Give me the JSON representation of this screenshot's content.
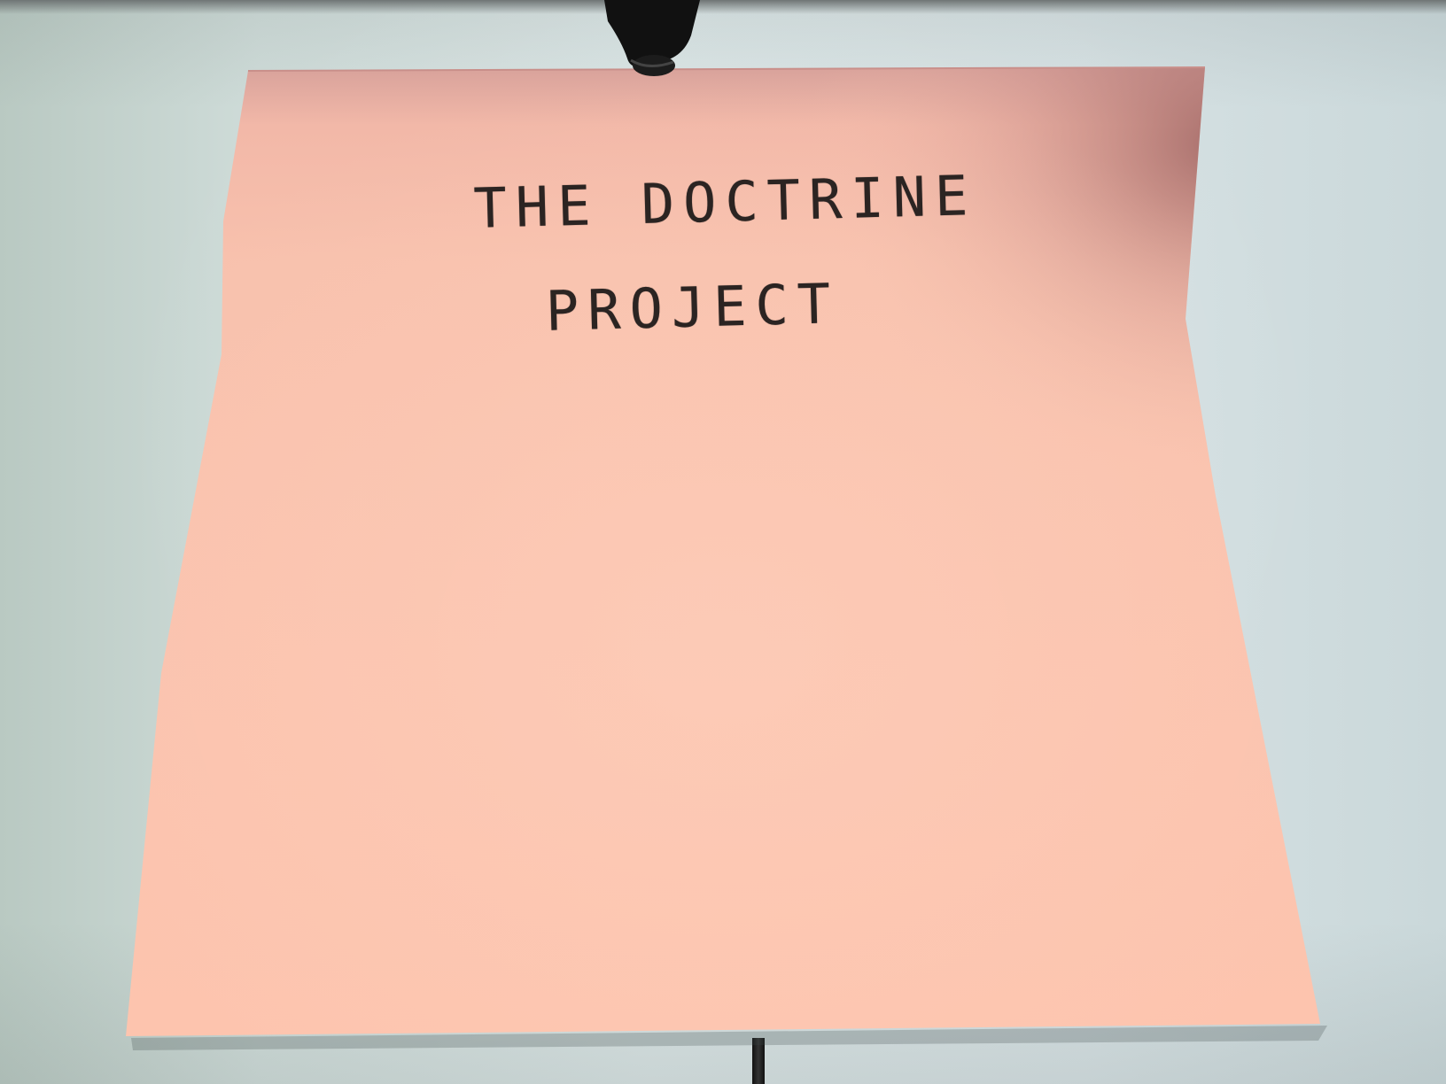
{
  "note": {
    "line_1": "THE DOCTRINE",
    "line_2": "PROJECT"
  },
  "colors": {
    "wall": "#d6e1e3",
    "sticky_note": "#fac0ac",
    "ink": "#2b2422",
    "clip": "#111111"
  },
  "icons": {
    "clip": "binder-clip-icon",
    "stand": "stand-pole-icon"
  }
}
